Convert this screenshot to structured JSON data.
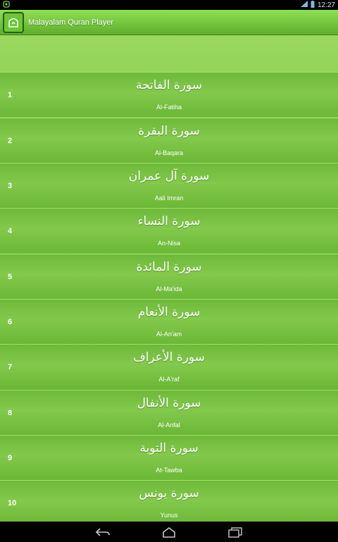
{
  "status_bar": {
    "time": "12:27",
    "icons": [
      "app-notification-icon",
      "signal-icon",
      "battery-icon"
    ]
  },
  "action_bar": {
    "title": "Malayalam Quran Player",
    "icon": "app-icon"
  },
  "surahs": [
    {
      "number": "1",
      "arabic": "سورة الفاتحة",
      "name": "Al-Fatiha"
    },
    {
      "number": "2",
      "arabic": "سورة البقرة",
      "name": "Al-Baqara"
    },
    {
      "number": "3",
      "arabic": "سورة آل عمران",
      "name": "Aali Imran"
    },
    {
      "number": "4",
      "arabic": "سورة النساء",
      "name": "An-Nisa"
    },
    {
      "number": "5",
      "arabic": "سورة المائدة",
      "name": "Al-Ma'ida"
    },
    {
      "number": "6",
      "arabic": "سورة الأنعام",
      "name": "Al-An'am"
    },
    {
      "number": "7",
      "arabic": "سورة الأعراف",
      "name": "Al-A'raf"
    },
    {
      "number": "8",
      "arabic": "سورة الأنفال",
      "name": "Al-Anfal"
    },
    {
      "number": "9",
      "arabic": "سورة التوبة",
      "name": "At-Tawba"
    },
    {
      "number": "10",
      "arabic": "سورة يونس",
      "name": "Yunus"
    }
  ],
  "nav_bar": {
    "buttons": [
      "back-icon",
      "home-icon",
      "recent-apps-icon"
    ]
  }
}
